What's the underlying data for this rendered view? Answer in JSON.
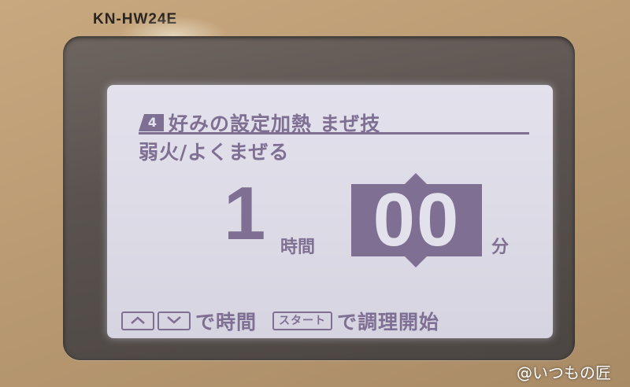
{
  "device": {
    "model": "KN-HW24E"
  },
  "screen": {
    "step_number": "4",
    "menu_title": "好みの設定加熱",
    "mode_label": "まぜ技",
    "heat_setting": "弱火/よくまぜる",
    "hours_value": "1",
    "hours_unit": "時間",
    "minutes_value": "00",
    "minutes_unit": "分",
    "footer": {
      "time_hint": "で時間",
      "start_key_label": "スタート",
      "start_hint": "で調理開始"
    }
  },
  "icons": {
    "up_key": "chevron-up-icon",
    "down_key": "chevron-down-icon",
    "increase_arrow": "triangle-up-icon",
    "decrease_arrow": "triangle-down-icon"
  },
  "colors": {
    "lcd_background": "#e3e1ec",
    "lcd_foreground": "#7e6f93",
    "device_body": "#c8a87f",
    "bezel": "#5a534f"
  },
  "watermark": "@いつもの匠"
}
